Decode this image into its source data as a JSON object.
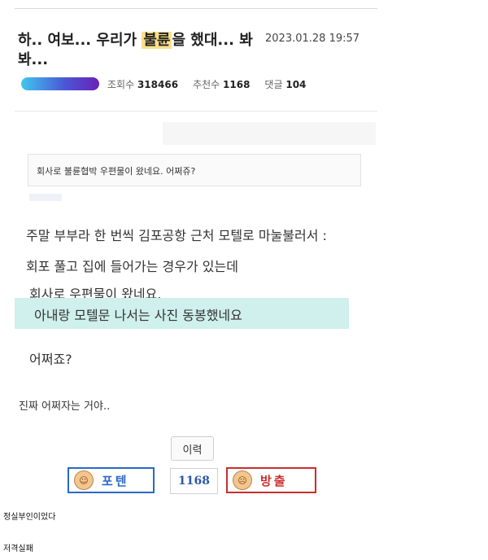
{
  "post": {
    "title_prefix": "하.. 여보... 우리가 ",
    "title_highlight": "불륜",
    "title_suffix": "을 했대... 봐봐...",
    "date": "2023.01.28 19:57",
    "views_label": "조회수",
    "views": "318466",
    "recommends_label": "추천수",
    "recommends": "1168",
    "comments_label": "댓글",
    "comments": "104"
  },
  "quote": {
    "text": "회사로 불륜협박 우편물이 왔네요. 어쩌쥬?"
  },
  "body": {
    "line1": "주말 부부라 한 번씩 김포공항 근처 모텔로 마눌불러서 :",
    "line2": "회포 풀고 집에 들어가는 경우가 있는데",
    "line3": "회사로 우편물이 왔네요.",
    "line4": "아내랑 모텔문 나서는 사진 동봉했네요",
    "line5": "어쩌죠?",
    "closing": "진짜 어쩌자는 거야.."
  },
  "actions": {
    "history_label": "이력",
    "upvote_label": "포텐",
    "vote_count": "1168",
    "downvote_label": "방출"
  },
  "comments_list": [
    {
      "text": "정실부인이었다"
    },
    {
      "text": "저격실패"
    }
  ],
  "colors": {
    "title_highlight": "#f8df8a",
    "quote_highlight": "#cff0ec",
    "upvote": "#2b68c7",
    "downvote": "#c92e2e"
  }
}
